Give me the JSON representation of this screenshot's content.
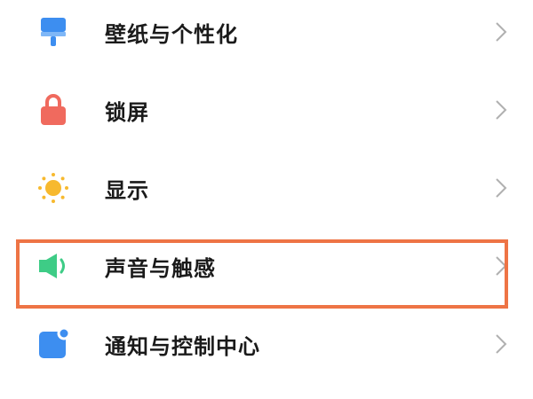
{
  "settings": {
    "items": [
      {
        "label": "壁纸与个性化",
        "icon": "wallpaper-brush-icon",
        "color": "#3d8ef0"
      },
      {
        "label": "锁屏",
        "icon": "lock-icon",
        "color": "#f06a5e"
      },
      {
        "label": "显示",
        "icon": "sun-icon",
        "color": "#f7b92e"
      },
      {
        "label": "声音与触感",
        "icon": "speaker-icon",
        "color": "#3ecc86"
      },
      {
        "label": "通知与控制中心",
        "icon": "notification-icon",
        "color": "#3d8ef0"
      }
    ],
    "highlight_color": "#ee7445"
  }
}
